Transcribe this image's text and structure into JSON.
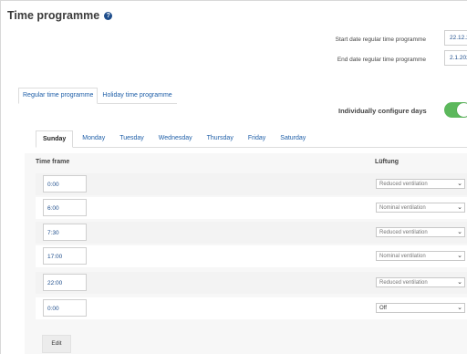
{
  "title": "Time programme",
  "help_icon": "question-circle-icon",
  "dates": {
    "start_label": "Start date regular time programme",
    "start_value": "22.12.2",
    "end_label": "End date regular time programme",
    "end_value": "2.1.202"
  },
  "prog_tabs": [
    "Regular time programme",
    "Holiday time programme"
  ],
  "individual_config": {
    "label": "Individually configure days",
    "enabled": true,
    "color": "#5cb85c"
  },
  "day_tabs": [
    "Sunday",
    "Monday",
    "Tuesday",
    "Wednesday",
    "Thursday",
    "Friday",
    "Saturday"
  ],
  "table": {
    "col_time": "Time frame",
    "col_vent": "Lüftung",
    "rows": [
      {
        "time": "0:00",
        "mode": "Reduced ventilation"
      },
      {
        "time": "6:00",
        "mode": "Nominal ventilation"
      },
      {
        "time": "7:30",
        "mode": "Reduced ventilation"
      },
      {
        "time": "17:00",
        "mode": "Nominal ventilation"
      },
      {
        "time": "22:00",
        "mode": "Reduced ventilation"
      },
      {
        "time": "0:00",
        "mode": "Off"
      }
    ]
  },
  "edit_label": "Edit",
  "colors": {
    "link": "#1f5fa8",
    "accent": "#1f4e8c",
    "toggle_on": "#5cb85c"
  }
}
